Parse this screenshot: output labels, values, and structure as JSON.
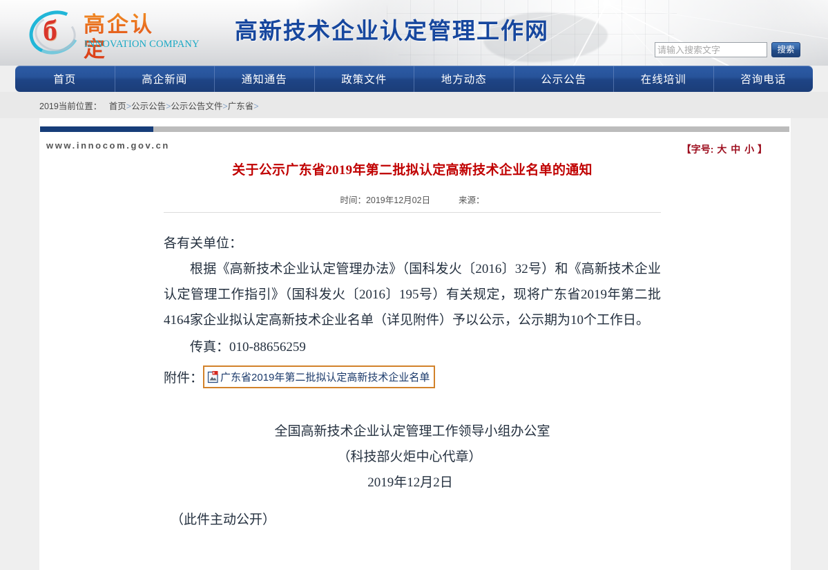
{
  "header": {
    "logo_mark": "б",
    "logo_cn": "高企认定",
    "logo_en": "INNOVATION COMPANY",
    "site_title": "高新技术企业认定管理工作网",
    "search_placeholder": "请输入搜索文字",
    "search_value": "",
    "search_button": "搜索"
  },
  "nav": {
    "items": [
      {
        "label": "首页"
      },
      {
        "label": "高企新闻"
      },
      {
        "label": "通知通告"
      },
      {
        "label": "政策文件"
      },
      {
        "label": "地方动态"
      },
      {
        "label": "公示公告"
      },
      {
        "label": "在线培训"
      },
      {
        "label": "咨询电话"
      }
    ]
  },
  "breadcrumb": {
    "prefix": "2019当前位置：",
    "items": [
      "首页",
      "公示公告",
      "公示公告文件",
      "广东省"
    ],
    "separator": ">"
  },
  "panel": {
    "site_url": "www.innocom.gov.cn",
    "fontsize": {
      "label": "【字号:",
      "large": "大",
      "medium": "中",
      "small": "小",
      "close": "】",
      "color": "#9e1020"
    }
  },
  "article": {
    "title": "关于公示广东省2019年第二批拟认定高新技术企业名单的通知",
    "title_color": "#c00000",
    "time_label": "时间：",
    "time_value": "2019年12月02日",
    "source_label": "来源：",
    "source_value": "",
    "salutation": "各有关单位：",
    "paragraph": "根据《高新技术企业认定管理办法》（国科发火〔2016〕32号）和《高新技术企业认定管理工作指引》（国科发火〔2016〕195号）有关规定，现将广东省2019年第二批4164家企业拟认定高新技术企业名单（详见附件）予以公示，公示期为10个工作日。",
    "fax": "传真：010-88656259",
    "attachment_label": "附件：",
    "attachment_name": "广东省2019年第二批拟认定高新技术企业名单",
    "attachment_icon": "file-pdf-icon",
    "attachment_highlight_color": "#d2822a",
    "signature_org": "全国高新技术企业认定管理工作领导小组办公室",
    "signature_seal": "（科技部火炬中心代章）",
    "signature_date": "2019年12月2日",
    "public_note": "（此件主动公开）"
  }
}
